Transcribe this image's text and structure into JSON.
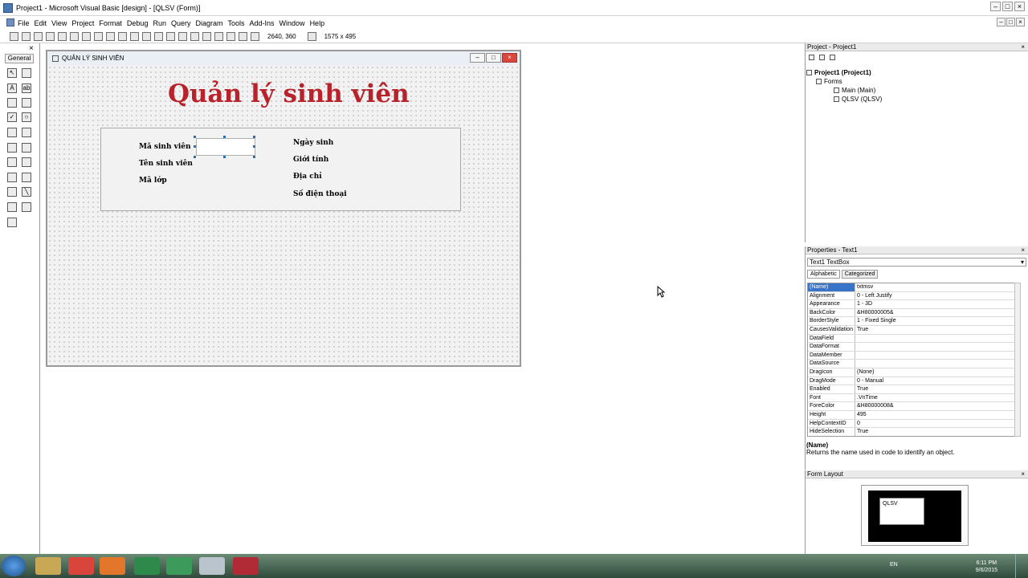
{
  "window": {
    "title": "Project1 - Microsoft Visual Basic [design] - [QLSV (Form)]"
  },
  "menu": [
    "File",
    "Edit",
    "View",
    "Project",
    "Format",
    "Debug",
    "Run",
    "Query",
    "Diagram",
    "Tools",
    "Add-Ins",
    "Window",
    "Help"
  ],
  "toolbar": {
    "position": "2640, 360",
    "size": "1575 x 495"
  },
  "toolbox": {
    "label": "General"
  },
  "form": {
    "caption": "QUẢN LÝ SINH VIÊN",
    "heading": "Quản lý sinh viên",
    "labels_left": [
      "Mã sinh viên",
      "Tên sinh viên",
      "Mã lớp"
    ],
    "labels_right": [
      "Ngày sinh",
      "Giới tính",
      "Địa chỉ",
      "Số điện thoại"
    ]
  },
  "project": {
    "title": "Project - Project1",
    "tree": [
      "Project1 (Project1)",
      "Forms",
      "Main (Main)",
      "QLSV (QLSV)"
    ]
  },
  "properties": {
    "title": "Properties - Text1",
    "object": "Text1 TextBox",
    "tabs": [
      "Alphabetic",
      "Categorized"
    ],
    "rows": [
      [
        "(Name)",
        "txtmsv"
      ],
      [
        "Alignment",
        "0 - Left Justify"
      ],
      [
        "Appearance",
        "1 - 3D"
      ],
      [
        "BackColor",
        "&H80000005&"
      ],
      [
        "BorderStyle",
        "1 - Fixed Single"
      ],
      [
        "CausesValidation",
        "True"
      ],
      [
        "DataField",
        ""
      ],
      [
        "DataFormat",
        ""
      ],
      [
        "DataMember",
        ""
      ],
      [
        "DataSource",
        ""
      ],
      [
        "DragIcon",
        "(None)"
      ],
      [
        "DragMode",
        "0 - Manual"
      ],
      [
        "Enabled",
        "True"
      ],
      [
        "Font",
        ".VnTime"
      ],
      [
        "ForeColor",
        "&H80000008&"
      ],
      [
        "Height",
        "495"
      ],
      [
        "HelpContextID",
        "0"
      ],
      [
        "HideSelection",
        "True"
      ]
    ],
    "desc_title": "(Name)",
    "desc_text": "Returns the name used in code to identify an object."
  },
  "form_layout": {
    "title": "Form Layout",
    "preview_label": "QLSV"
  },
  "taskbar": {
    "lang": "EN",
    "time": "6:11 PM",
    "date": "9/6/2015"
  }
}
